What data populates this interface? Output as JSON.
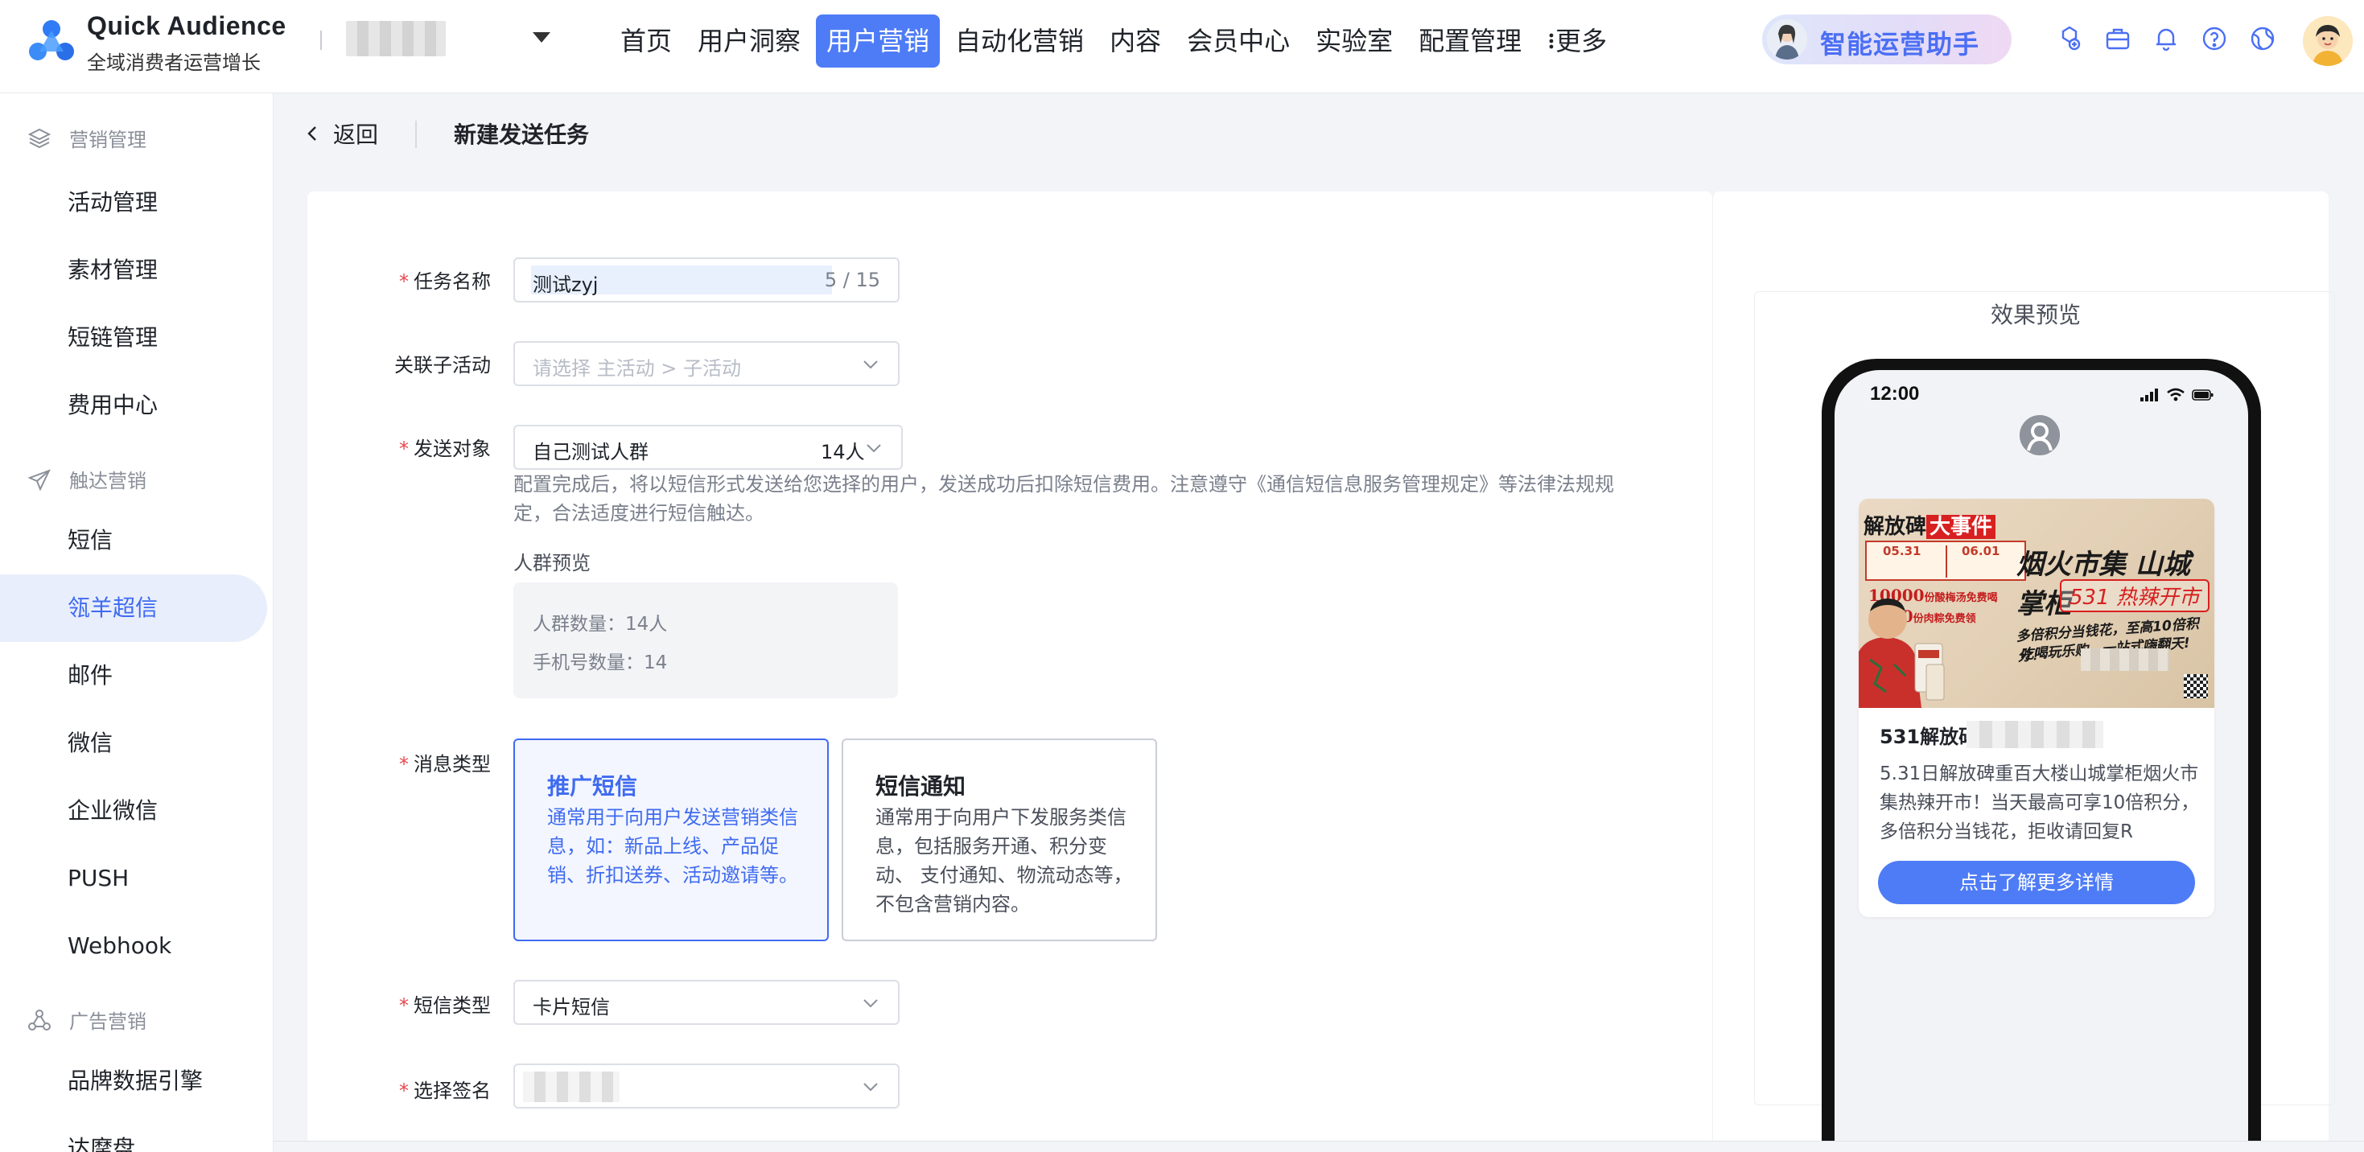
{
  "brand": {
    "name": "Quick Audience",
    "subtitle": "全域消费者运营增长"
  },
  "nav": {
    "items": [
      "首页",
      "用户洞察",
      "用户营销",
      "自动化营销",
      "内容",
      "会员中心",
      "实验室",
      "配置管理"
    ],
    "active": "用户营销",
    "more": "更多"
  },
  "assistant": {
    "label": "智能运营助手"
  },
  "colors": {
    "accent": "#4e7cf6",
    "required": "#e5484d",
    "assistant_text": "#4b6ff4"
  },
  "sidebar": {
    "groups": [
      {
        "label": "营销管理",
        "icon": "layers-icon",
        "items": [
          "活动管理",
          "素材管理",
          "短链管理",
          "费用中心"
        ]
      },
      {
        "label": "触达营销",
        "icon": "send-icon",
        "items": [
          "短信",
          "瓴羊超信",
          "邮件",
          "微信",
          "企业微信",
          "PUSH",
          "Webhook"
        ]
      },
      {
        "label": "广告营销",
        "icon": "share-nodes-icon",
        "items": [
          "品牌数据引擎",
          "达摩盘"
        ]
      }
    ],
    "active_item": "瓴羊超信"
  },
  "header": {
    "back": "返回",
    "title": "新建发送任务"
  },
  "form": {
    "task_name": {
      "label": "任务名称",
      "value": "测试zyj",
      "counter": "5 / 15"
    },
    "sub_activity": {
      "label": "关联子活动",
      "placeholder": "请选择 主活动 > 子活动"
    },
    "target": {
      "label": "发送对象",
      "value": "自己测试人群",
      "count": "14人",
      "hint": "配置完成后，将以短信形式发送给您选择的用户，发送成功后扣除短信费用。注意遵守《通信短信息服务管理规定》等法律法规规定，合法适度进行短信触达。",
      "preview_label": "人群预览",
      "crowd_count": "人群数量：14人",
      "phone_count": "手机号数量：14"
    },
    "message_type": {
      "label": "消息类型",
      "options": [
        {
          "title": "推广短信",
          "desc": "通常用于向用户发送营销类信息，如：新品上线、产品促销、折扣送券、活动邀请等。",
          "selected": true
        },
        {
          "title": "短信通知",
          "desc": "通常用于向用户下发服务类信息，包括服务开通、积分变动、 支付通知、物流动态等，不包含营销内容。",
          "selected": false
        }
      ]
    },
    "sms_type": {
      "label": "短信类型",
      "value": "卡片短信"
    },
    "signature": {
      "label": "选择签名"
    }
  },
  "preview": {
    "title": "效果预览",
    "time": "12:00",
    "poster": {
      "brand_top": "解放碑",
      "brand_highlight": "大事件",
      "date1": "05.31",
      "date2": "06.01",
      "promo1": "10000",
      "promo1_suffix": "份酸梅汤免费喝",
      "promo2": "1000",
      "promo2_suffix": "份肉粽免费领",
      "main": "烟火市集 山城掌柜",
      "tag": "531 热辣开市",
      "sub1": "多倍积分当钱花，至高10倍积分！",
      "sub2": "吃喝玩乐购，一站式嗨翻天!"
    },
    "msg_title": "531解放碑",
    "msg_body": "5.31日解放碑重百大楼山城掌柜烟火市集热辣开市！当天最高可享10倍积分，多倍积分当钱花，拒收请回复R",
    "button": "点击了解更多详情"
  }
}
